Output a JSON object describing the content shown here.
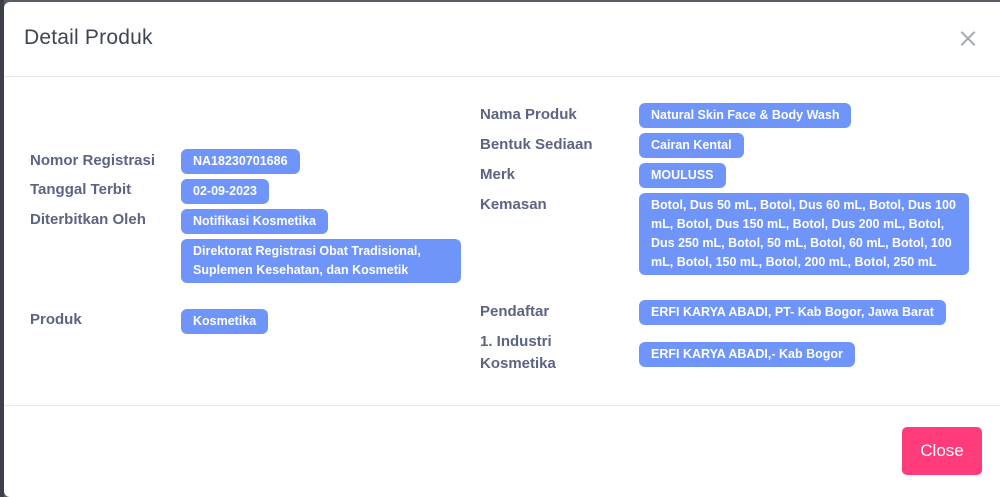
{
  "modal": {
    "title": "Detail Produk",
    "close_button_label": "Close"
  },
  "left": {
    "nomor_registrasi": {
      "label": "Nomor Registrasi",
      "value": "NA18230701686"
    },
    "tanggal_terbit": {
      "label": "Tanggal Terbit",
      "value": "02-09-2023"
    },
    "diterbitkan_oleh": {
      "label": "Diterbitkan Oleh",
      "value": "Notifikasi Kosmetika",
      "value2": "Direktorat Registrasi Obat Tradisional, Suplemen Kesehatan, dan Kosmetik"
    },
    "produk": {
      "label": "Produk",
      "value": "Kosmetika"
    }
  },
  "right": {
    "nama_produk": {
      "label": "Nama Produk",
      "value": "Natural Skin Face & Body Wash"
    },
    "bentuk_sediaan": {
      "label": "Bentuk Sediaan",
      "value": "Cairan Kental"
    },
    "merk": {
      "label": "Merk",
      "value": "MOULUSS"
    },
    "kemasan": {
      "label": "Kemasan",
      "value": "Botol, Dus 50 mL, Botol, Dus 60 mL, Botol, Dus 100 mL, Botol, Dus 150 mL, Botol, Dus 200 mL, Botol, Dus 250 mL, Botol, 50 mL, Botol, 60 mL, Botol, 100 mL, Botol, 150 mL, Botol, 200 mL, Botol, 250 mL"
    },
    "pendaftar": {
      "label": "Pendaftar",
      "value": "ERFI KARYA ABADI, PT- Kab Bogor, Jawa Barat"
    },
    "industri": {
      "label": "1. Industri Kosmetika",
      "value": "ERFI KARYA ABADI,- Kab Bogor"
    }
  }
}
